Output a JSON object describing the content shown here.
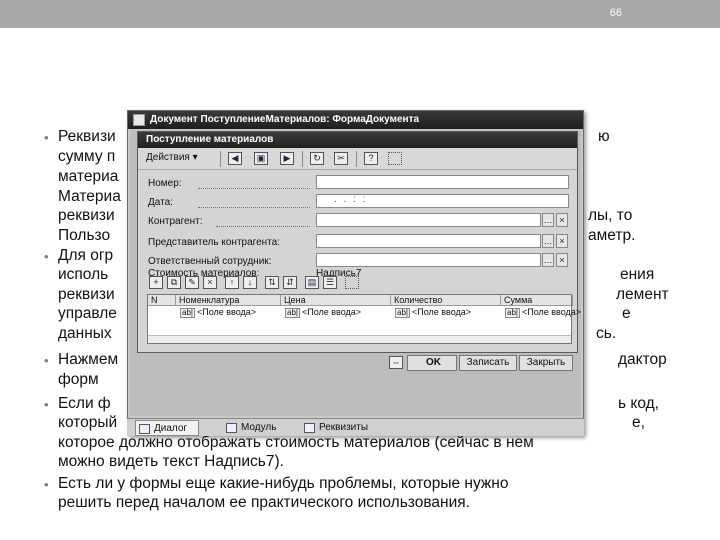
{
  "slide": {
    "number": "66"
  },
  "bullets": {
    "b1_lines": [
      "Реквизи",
      "сумму п",
      "материа",
      "Материа",
      "реквизи",
      "Пользо"
    ],
    "b1_right": [
      "ю",
      "",
      "",
      "",
      "лы, то",
      "аметр."
    ],
    "b2_lines": [
      "Для огр",
      "исполь",
      "реквизи",
      "управле",
      "данных"
    ],
    "b2_right": [
      "ения",
      "лемент",
      "е",
      "сь.",
      ""
    ],
    "b3_lines": [
      "Нажмем",
      "форм"
    ],
    "b3_right": [
      "дактор",
      ""
    ],
    "b4_lines": [
      "Если ф",
      "который",
      "которое должно отображать стоимость материалов (сейчас в нем",
      "можно видеть текст Надпись7)."
    ],
    "b4_right": [
      "ь код,",
      "е,",
      "",
      ""
    ],
    "b5_lines": [
      "Есть ли у формы еще какие-нибудь проблемы, которые нужно",
      "решить перед началом ее практического использования."
    ]
  },
  "window": {
    "title": "Документ ПоступлениеМатериалов: ФормаДокумента",
    "inner_title": "Поступление материалов",
    "toolbar": {
      "actions_label": "Действия ▾",
      "help_label": "?"
    },
    "fields": {
      "number_label": "Номер:",
      "date_label": "Дата:",
      "date_value": ". .  : :",
      "contractor_label": "Контрагент:",
      "contractor_rep_label": "Представитель контрагента:",
      "employee_label": "Ответственный сотрудник:",
      "cost_label": "Стоимость материалов:",
      "cost_value": "Надпись7"
    },
    "grid": {
      "columns": [
        "N",
        "Номенклатура",
        "Цена",
        "Количество",
        "Сумма"
      ],
      "row": [
        "",
        "<Поле ввода>",
        "<Поле ввода>",
        "<Поле ввода>",
        "<Поле ввода>"
      ],
      "pill": "ab|"
    },
    "buttons": {
      "ok": "OK",
      "save": "Записать",
      "close": "Закрыть"
    },
    "tabs": [
      "Диалог",
      "Модуль",
      "Реквизиты"
    ]
  }
}
